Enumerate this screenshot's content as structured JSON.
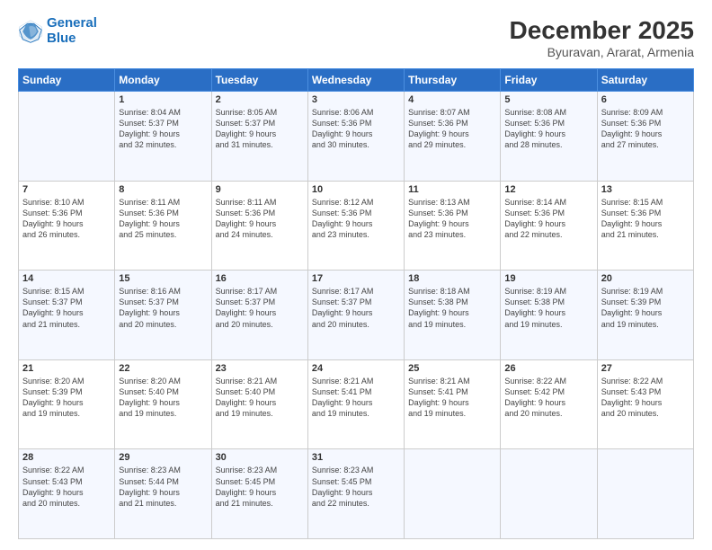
{
  "logo": {
    "line1": "General",
    "line2": "Blue"
  },
  "title": "December 2025",
  "subtitle": "Byuravan, Ararat, Armenia",
  "header_days": [
    "Sunday",
    "Monday",
    "Tuesday",
    "Wednesday",
    "Thursday",
    "Friday",
    "Saturday"
  ],
  "weeks": [
    [
      {
        "day": "",
        "info": ""
      },
      {
        "day": "1",
        "info": "Sunrise: 8:04 AM\nSunset: 5:37 PM\nDaylight: 9 hours\nand 32 minutes."
      },
      {
        "day": "2",
        "info": "Sunrise: 8:05 AM\nSunset: 5:37 PM\nDaylight: 9 hours\nand 31 minutes."
      },
      {
        "day": "3",
        "info": "Sunrise: 8:06 AM\nSunset: 5:36 PM\nDaylight: 9 hours\nand 30 minutes."
      },
      {
        "day": "4",
        "info": "Sunrise: 8:07 AM\nSunset: 5:36 PM\nDaylight: 9 hours\nand 29 minutes."
      },
      {
        "day": "5",
        "info": "Sunrise: 8:08 AM\nSunset: 5:36 PM\nDaylight: 9 hours\nand 28 minutes."
      },
      {
        "day": "6",
        "info": "Sunrise: 8:09 AM\nSunset: 5:36 PM\nDaylight: 9 hours\nand 27 minutes."
      }
    ],
    [
      {
        "day": "7",
        "info": "Sunrise: 8:10 AM\nSunset: 5:36 PM\nDaylight: 9 hours\nand 26 minutes."
      },
      {
        "day": "8",
        "info": "Sunrise: 8:11 AM\nSunset: 5:36 PM\nDaylight: 9 hours\nand 25 minutes."
      },
      {
        "day": "9",
        "info": "Sunrise: 8:11 AM\nSunset: 5:36 PM\nDaylight: 9 hours\nand 24 minutes."
      },
      {
        "day": "10",
        "info": "Sunrise: 8:12 AM\nSunset: 5:36 PM\nDaylight: 9 hours\nand 23 minutes."
      },
      {
        "day": "11",
        "info": "Sunrise: 8:13 AM\nSunset: 5:36 PM\nDaylight: 9 hours\nand 23 minutes."
      },
      {
        "day": "12",
        "info": "Sunrise: 8:14 AM\nSunset: 5:36 PM\nDaylight: 9 hours\nand 22 minutes."
      },
      {
        "day": "13",
        "info": "Sunrise: 8:15 AM\nSunset: 5:36 PM\nDaylight: 9 hours\nand 21 minutes."
      }
    ],
    [
      {
        "day": "14",
        "info": "Sunrise: 8:15 AM\nSunset: 5:37 PM\nDaylight: 9 hours\nand 21 minutes."
      },
      {
        "day": "15",
        "info": "Sunrise: 8:16 AM\nSunset: 5:37 PM\nDaylight: 9 hours\nand 20 minutes."
      },
      {
        "day": "16",
        "info": "Sunrise: 8:17 AM\nSunset: 5:37 PM\nDaylight: 9 hours\nand 20 minutes."
      },
      {
        "day": "17",
        "info": "Sunrise: 8:17 AM\nSunset: 5:37 PM\nDaylight: 9 hours\nand 20 minutes."
      },
      {
        "day": "18",
        "info": "Sunrise: 8:18 AM\nSunset: 5:38 PM\nDaylight: 9 hours\nand 19 minutes."
      },
      {
        "day": "19",
        "info": "Sunrise: 8:19 AM\nSunset: 5:38 PM\nDaylight: 9 hours\nand 19 minutes."
      },
      {
        "day": "20",
        "info": "Sunrise: 8:19 AM\nSunset: 5:39 PM\nDaylight: 9 hours\nand 19 minutes."
      }
    ],
    [
      {
        "day": "21",
        "info": "Sunrise: 8:20 AM\nSunset: 5:39 PM\nDaylight: 9 hours\nand 19 minutes."
      },
      {
        "day": "22",
        "info": "Sunrise: 8:20 AM\nSunset: 5:40 PM\nDaylight: 9 hours\nand 19 minutes."
      },
      {
        "day": "23",
        "info": "Sunrise: 8:21 AM\nSunset: 5:40 PM\nDaylight: 9 hours\nand 19 minutes."
      },
      {
        "day": "24",
        "info": "Sunrise: 8:21 AM\nSunset: 5:41 PM\nDaylight: 9 hours\nand 19 minutes."
      },
      {
        "day": "25",
        "info": "Sunrise: 8:21 AM\nSunset: 5:41 PM\nDaylight: 9 hours\nand 19 minutes."
      },
      {
        "day": "26",
        "info": "Sunrise: 8:22 AM\nSunset: 5:42 PM\nDaylight: 9 hours\nand 20 minutes."
      },
      {
        "day": "27",
        "info": "Sunrise: 8:22 AM\nSunset: 5:43 PM\nDaylight: 9 hours\nand 20 minutes."
      }
    ],
    [
      {
        "day": "28",
        "info": "Sunrise: 8:22 AM\nSunset: 5:43 PM\nDaylight: 9 hours\nand 20 minutes."
      },
      {
        "day": "29",
        "info": "Sunrise: 8:23 AM\nSunset: 5:44 PM\nDaylight: 9 hours\nand 21 minutes."
      },
      {
        "day": "30",
        "info": "Sunrise: 8:23 AM\nSunset: 5:45 PM\nDaylight: 9 hours\nand 21 minutes."
      },
      {
        "day": "31",
        "info": "Sunrise: 8:23 AM\nSunset: 5:45 PM\nDaylight: 9 hours\nand 22 minutes."
      },
      {
        "day": "",
        "info": ""
      },
      {
        "day": "",
        "info": ""
      },
      {
        "day": "",
        "info": ""
      }
    ]
  ]
}
